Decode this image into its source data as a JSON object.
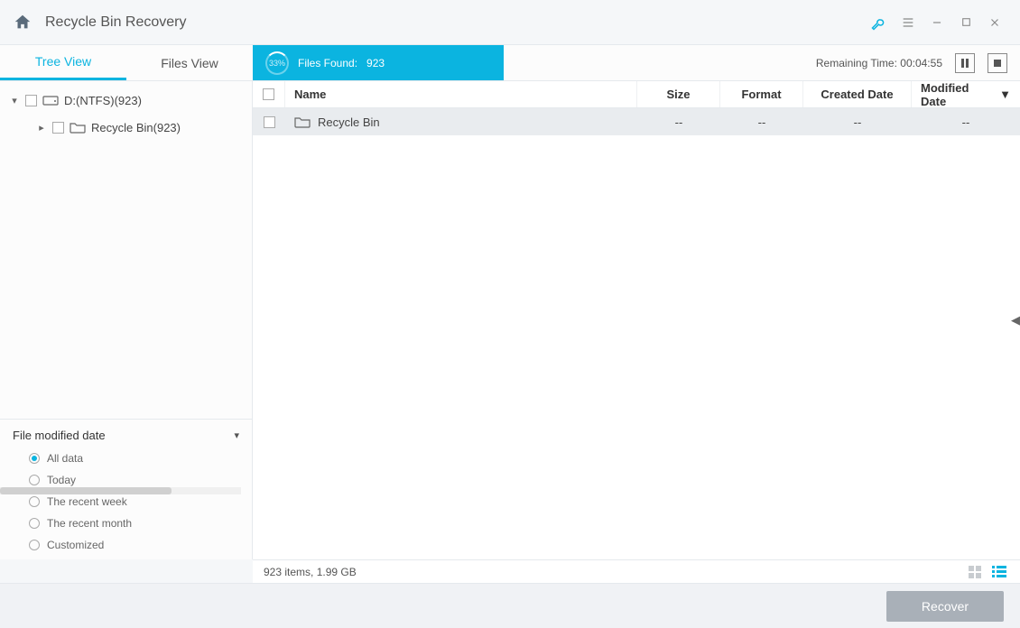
{
  "title": "Recycle Bin Recovery",
  "tabs": {
    "tree": "Tree View",
    "files": "Files View"
  },
  "progress": {
    "percent": "33%",
    "label": "Files Found:",
    "count": "923"
  },
  "remaining": {
    "label": "Remaining Time:",
    "value": "00:04:55"
  },
  "tree": {
    "drive": "D:(NTFS)(923)",
    "recycle": "Recycle Bin(923)"
  },
  "filter": {
    "title": "File modified date",
    "options": [
      "All data",
      "Today",
      "The recent week",
      "The recent month",
      "Customized"
    ]
  },
  "columns": {
    "name": "Name",
    "size": "Size",
    "format": "Format",
    "created": "Created Date",
    "modified": "Modified Date"
  },
  "rows": [
    {
      "name": "Recycle Bin",
      "size": "--",
      "format": "--",
      "created": "--",
      "modified": "--"
    }
  ],
  "status": "923 items, 1.99 GB",
  "recover": "Recover"
}
